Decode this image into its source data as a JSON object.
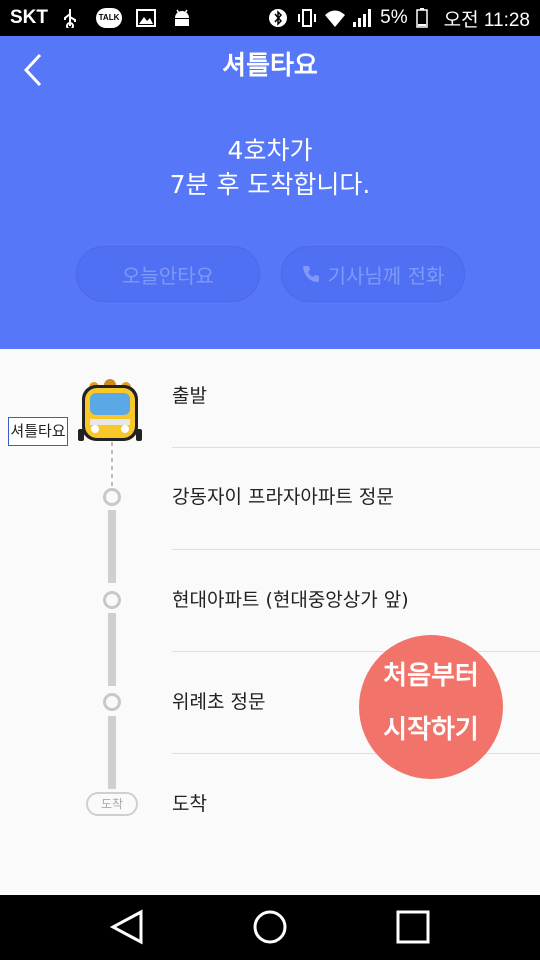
{
  "statusbar": {
    "carrier": "SKT",
    "icons": [
      "usb-icon",
      "kakaotalk-icon",
      "image-icon",
      "android-icon",
      "bluetooth-icon",
      "vibrate-icon",
      "wifi-icon",
      "signal-icon",
      "battery-icon"
    ],
    "talk": "TALK",
    "battery": "5%",
    "time": "오전 11:28"
  },
  "header": {
    "title": "셔틀타요",
    "message_line1": "4호차가",
    "message_line2": "7분 후 도착합니다.",
    "button_absent": "오늘안타요",
    "button_call": "기사님께 전화",
    "bg_color": "#5677f8"
  },
  "route": {
    "bus_tag": "셔틀타요",
    "stops": [
      {
        "label": "출발"
      },
      {
        "label": "강동자이 프라자아파트 정문"
      },
      {
        "label": "현대아파트 (현대중앙상가 앞)"
      },
      {
        "label": "위례초 정문"
      },
      {
        "label": "도착"
      }
    ],
    "arrive_badge": "도착"
  },
  "fab": {
    "line1": "처음부터",
    "line2": "시작하기",
    "color": "#f2736a"
  }
}
